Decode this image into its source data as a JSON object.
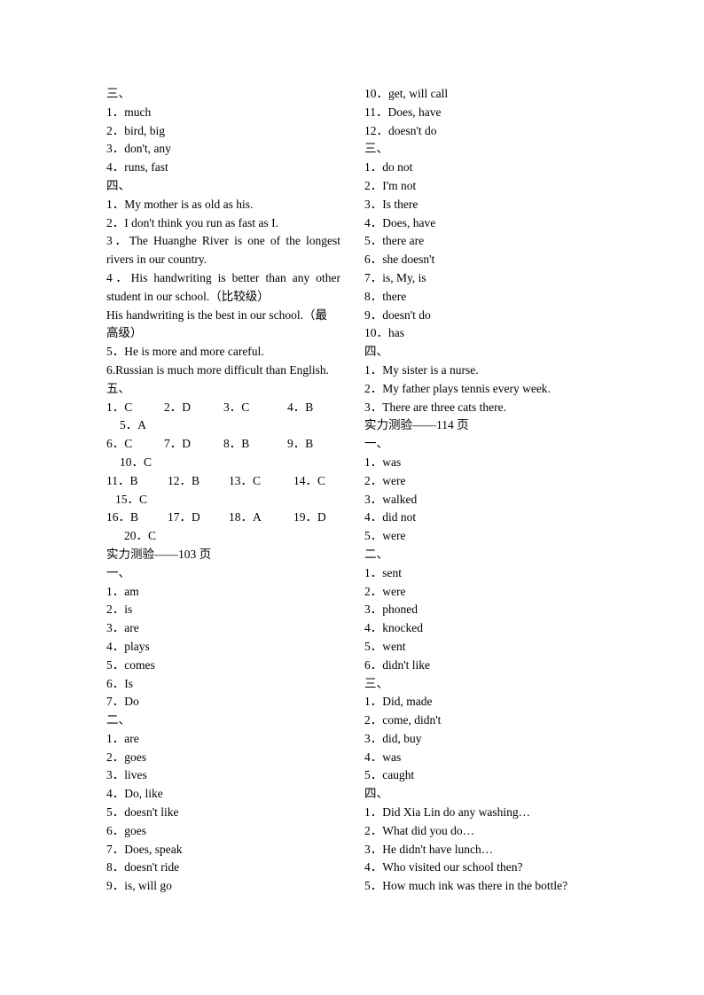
{
  "left": [
    "三、",
    "1．much",
    "2．bird, big",
    "3．don't, any",
    "4．runs, fast",
    "四、",
    "1．My mother is as old as his.",
    "2．I don't think you run as fast as I.",
    "3．The Huanghe River is one of the longest",
    "rivers in our country.",
    "4．His handwriting is better than any other",
    "student in our school.（比较级）",
    "His handwriting is the best in our school.（最",
    "高级）",
    "5．He is more and more careful.",
    "6.Russian is much more difficult than English.",
    "五、",
    [
      "1．C",
      "2．D",
      "3．C",
      "4．B"
    ],
    [
      "5．A"
    ],
    [
      "6．C",
      "7．D",
      "8．B",
      "9．B"
    ],
    [
      "10．C"
    ],
    [
      "11．B",
      "12．B",
      "13．C",
      "14．C"
    ],
    [
      "15．C"
    ],
    [
      "16．B",
      "17．D",
      "18．A",
      "19．D"
    ],
    [
      "20．C"
    ],
    "实力测验——103 页",
    "一、",
    "1．am",
    "2．is",
    "3．are",
    "4．plays",
    "5．comes",
    "6．Is",
    "7．Do",
    "二、",
    "1．are",
    "2．goes",
    "3．lives",
    "4．Do, like",
    "5．doesn't like",
    "6．goes",
    "7．Does, speak",
    "8．doesn't ride",
    "9．is, will go"
  ],
  "right": [
    "10．get, will call",
    "11．Does, have",
    "12．doesn't do",
    "三、",
    "1．do not",
    "2．I'm not",
    "3．Is there",
    "4．Does, have",
    "5．there are",
    "6．she doesn't",
    "7．is, My, is",
    "8．there",
    "9．doesn't do",
    "10．has",
    "四、",
    "1．My sister is a nurse.",
    "2．My father plays tennis every week.",
    "3．There are three cats there.",
    "实力测验——114 页",
    "一、",
    "1．was",
    "2．were",
    "3．walked",
    "4．did not",
    "5．were",
    "二、",
    "1．sent",
    "2．were",
    "3．phoned",
    "4．knocked",
    "5．went",
    "6．didn't like",
    "三、",
    "1．Did, made",
    "2．come, didn't",
    "3．did, buy",
    "4．was",
    "5．caught",
    "四、",
    "1．Did Xia Lin do any washing…",
    "2．What did you do…",
    "3．He didn't have lunch…",
    "4．Who visited our school then?",
    "5．How much ink was there in the bottle?"
  ]
}
